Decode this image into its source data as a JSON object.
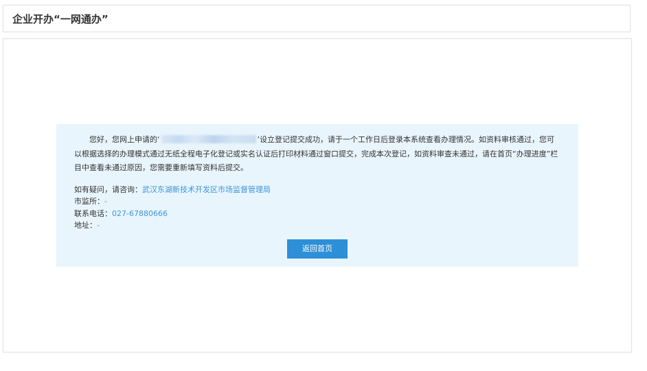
{
  "header": {
    "title": "企业开办“一网通办”"
  },
  "notice": {
    "message_prefix": "您好，您网上申请的‘",
    "message_suffix": "’设立登记提交成功，请于一个工作日后登录本系统查看办理情况。如资料审核通过，您可以根据选择的办理模式通过无纸全程电子化登记或实名认证后打印材料通过窗口提交，完成本次登记，如资料审查未通过，请在首页“办理进度”栏目中查看未通过原因，您需要重新填写资料后提交。",
    "contact": {
      "inquiry_label": "如有疑问，请咨询：",
      "inquiry_value": "武汉东湖新技术开发区市场监督管理局",
      "office_label": "市监所：",
      "office_value": "-",
      "phone_label": "联系电话：",
      "phone_value": "027-67880666",
      "address_label": "地址：",
      "address_value": "-"
    },
    "button_label": "返回首页"
  },
  "colors": {
    "accent": "#2d8fd7",
    "link": "#3a95d9",
    "notice_bg": "#e9f5fd",
    "text": "#333333"
  }
}
